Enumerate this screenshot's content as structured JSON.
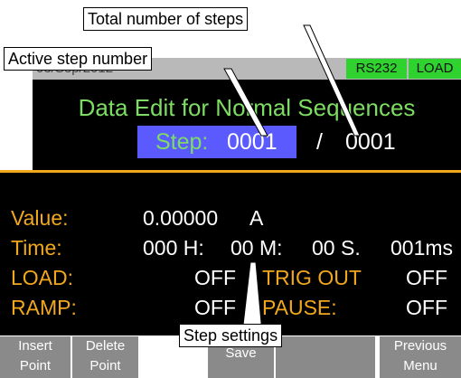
{
  "status": {
    "date": "03/Sep/2012",
    "badges": [
      "RS232",
      "LOAD"
    ]
  },
  "header": {
    "title": "Data Edit for Normal Sequences",
    "step_label": "Step:",
    "step_value": "0001",
    "separator": "/",
    "step_total": "0001"
  },
  "settings": {
    "value_label": "Value:",
    "value_number": "0.00000",
    "value_unit": "A",
    "time_label": "Time:",
    "time_h": "000 H:",
    "time_m": "00 M:",
    "time_s": "00 S.",
    "time_ms": "001ms",
    "load_label": "LOAD:",
    "load_value": "OFF",
    "trig_label": "TRIG OUT",
    "trig_value": "OFF",
    "ramp_label": "RAMP:",
    "ramp_value": "OFF",
    "pause_label": "PAUSE:",
    "pause_value": "OFF"
  },
  "softkeys": [
    {
      "line1": "Insert",
      "line2": "Point"
    },
    {
      "line1": "Delete",
      "line2": "Point"
    },
    {
      "line1": "Save",
      "line2": ""
    },
    {
      "line1": "",
      "line2": ""
    },
    {
      "line1": "Previous",
      "line2": "Menu"
    }
  ],
  "annotations": {
    "total_steps": "Total number of steps",
    "active_step": "Active step number",
    "step_settings": "Step settings"
  },
  "colors": {
    "title_green": "#7ddc62",
    "label_orange": "#f2a81d",
    "highlight_blue": "#5a5aff",
    "badge_green": "#2fd22f",
    "softkey_gray": "#8a8a8a"
  }
}
